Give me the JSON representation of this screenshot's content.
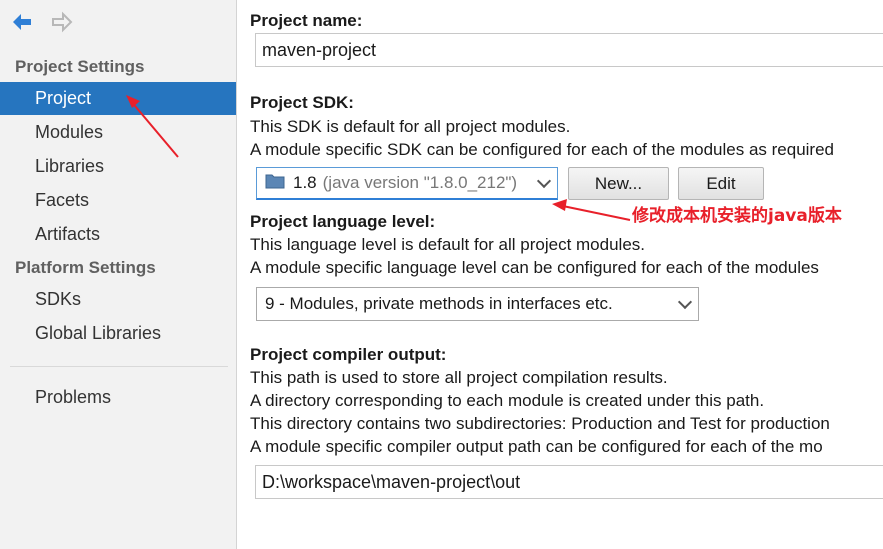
{
  "sidebar": {
    "project_settings_header": "Project Settings",
    "platform_settings_header": "Platform Settings",
    "items": {
      "project": "Project",
      "modules": "Modules",
      "libraries": "Libraries",
      "facets": "Facets",
      "artifacts": "Artifacts",
      "sdks": "SDKs",
      "global_libraries": "Global Libraries",
      "problems": "Problems"
    },
    "selected": "Project"
  },
  "main": {
    "project_name": {
      "label": "Project name:",
      "value": "maven-project"
    },
    "project_sdk": {
      "label": "Project SDK:",
      "desc1": "This SDK is default for all project modules.",
      "desc2": "A module specific SDK can be configured for each of the modules as required",
      "sdk_version": "1.8",
      "sdk_detail": "(java version \"1.8.0_212\")",
      "new_button": "New...",
      "edit_button": "Edit"
    },
    "language_level": {
      "label": "Project language level:",
      "desc1": "This language level is default for all project modules.",
      "desc2": "A module specific language level can be configured for each of the modules",
      "value": "9 - Modules, private methods in interfaces etc."
    },
    "compiler_output": {
      "label": "Project compiler output:",
      "desc1": "This path is used to store all project compilation results.",
      "desc2": "A directory corresponding to each module is created under this path.",
      "desc3": "This directory contains two subdirectories: Production and Test for production",
      "desc4": "A module specific compiler output path can be configured for each of the mo",
      "value": "D:\\workspace\\maven-project\\out"
    }
  },
  "annotation": {
    "text": "修改成本机安装的java版本",
    "color": "#e8202a"
  },
  "colors": {
    "selection": "#2675bf",
    "back_arrow": "#2f7fd6",
    "forward_arrow_disabled": "#b8b8b8"
  }
}
